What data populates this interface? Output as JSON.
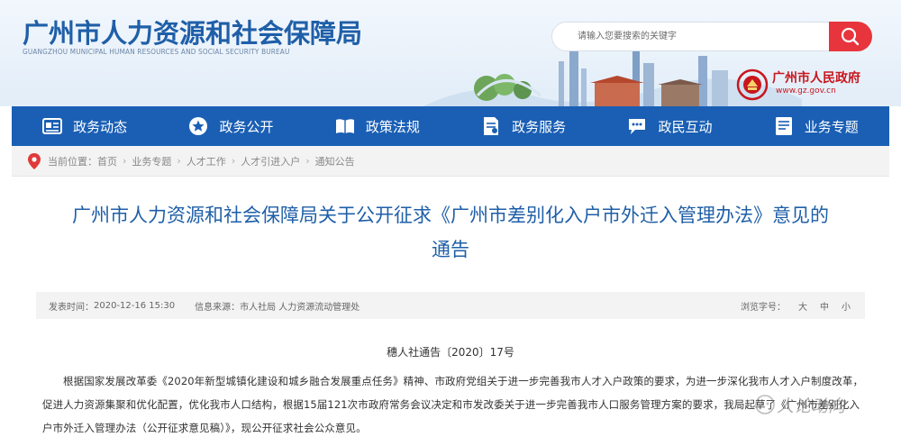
{
  "hdr": {
    "title": "广州市人力资源和社会保障局",
    "subtitle": "GUANGZHOU MUNICIPAL HUMAN RESOURCES AND SOCIAL SECURITY BUREAU",
    "search_placeholder": "请输入您要搜索的关键字",
    "gov_name": "广州市人民政府",
    "gov_url": "www.gz.gov.cn"
  },
  "nav": [
    {
      "label": "政务动态",
      "icon": "news-icon"
    },
    {
      "label": "政务公开",
      "icon": "star-icon"
    },
    {
      "label": "政策法规",
      "icon": "book-icon"
    },
    {
      "label": "政务服务",
      "icon": "service-icon"
    },
    {
      "label": "政民互动",
      "icon": "chat-icon"
    },
    {
      "label": "业务专题",
      "icon": "topic-icon"
    }
  ],
  "crumb": {
    "prefix": "当前位置：",
    "items": [
      "首页",
      "业务专题",
      "人才工作",
      "人才引进入户",
      "通知公告"
    ],
    "sep": "›"
  },
  "article": {
    "title_line1": "广州市人力资源和社会保障局关于公开征求《广州市差别化入户市外迁入管理办法》意见的",
    "title_line2": "通告",
    "meta_date_label": "发表时间：",
    "meta_date": "2020-12-16 15:30",
    "meta_source_label": "信息来源：",
    "meta_source": "市人社局 人力资源流动管理处",
    "font_label": "浏览字号：",
    "font_sizes": [
      "大",
      "中",
      "小"
    ],
    "doc_no": "穗人社通告〔2020〕17号",
    "p1": "根据国家发展改革委《2020年新型城镇化建设和城乡融合发展重点任务》精神、市政府党组关于进一步完善我市人才入户政策的要求，为进一步深化我市人才入户制度改革，促进人力资源集聚和优化配置，优化我市人口结构，根据15届121次市政府常务会议决定和市发改委关于进一步完善我市人口服务管理方案的要求，我局起草了《广州市差别化入户市外迁入管理办法（公开征求意见稿）》，现公开征求社会公众意见。",
    "watermark": "人论动向"
  },
  "colors": {
    "nav_bg": "#1a5fb4",
    "title_blue": "#1f5fa8",
    "search_btn": "#e8343c",
    "gov_red": "#c8161d"
  }
}
